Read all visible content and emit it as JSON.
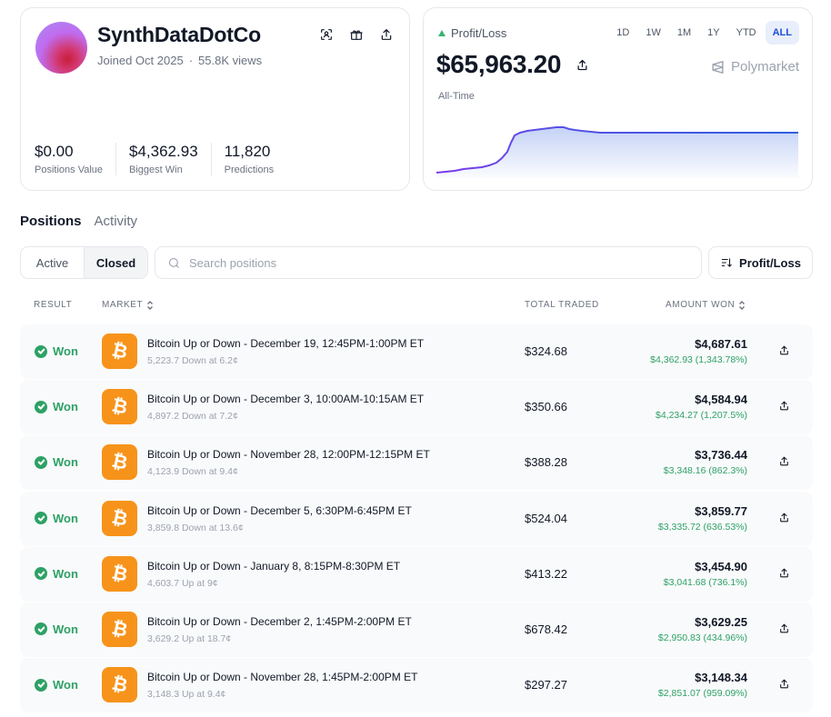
{
  "profile": {
    "username": "SynthDataDotCo",
    "joined": "Joined Oct 2025",
    "views": "55.8K views",
    "separator": "·",
    "stats": [
      {
        "value": "$0.00",
        "label": "Positions Value"
      },
      {
        "value": "$4,362.93",
        "label": "Biggest Win"
      },
      {
        "value": "11,820",
        "label": "Predictions"
      }
    ],
    "icons": [
      "scan-icon",
      "gift-icon",
      "share-icon"
    ]
  },
  "pnl": {
    "label": "Profit/Loss",
    "value": "$65,963.20",
    "brand": "Polymarket",
    "period_label": "All-Time",
    "ranges": [
      "1D",
      "1W",
      "1M",
      "1Y",
      "YTD",
      "ALL"
    ],
    "active_range": "ALL",
    "colors": {
      "line_start": "#7c3aed",
      "line_end": "#2f5fe0",
      "up": "#3bb273"
    }
  },
  "tabs": [
    {
      "label": "Positions",
      "active": true
    },
    {
      "label": "Activity",
      "active": false
    }
  ],
  "filter": {
    "active_label": "Active",
    "closed_label": "Closed",
    "selected": "Closed"
  },
  "search": {
    "placeholder": "Search positions",
    "value": ""
  },
  "sort": {
    "label": "Profit/Loss"
  },
  "table": {
    "headers": {
      "result": "RESULT",
      "market": "MARKET",
      "total_traded": "TOTAL TRADED",
      "amount_won": "AMOUNT WON"
    },
    "rows": [
      {
        "result": "Won",
        "title": "Bitcoin Up or Down - December 19, 12:45PM-1:00PM ET",
        "sub": "5,223.7 Down at 6.2¢",
        "traded": "$324.68",
        "won": "$4,687.61",
        "gain": "$4,362.93 (1,343.78%)"
      },
      {
        "result": "Won",
        "title": "Bitcoin Up or Down - December 3, 10:00AM-10:15AM ET",
        "sub": "4,897.2 Down at 7.2¢",
        "traded": "$350.66",
        "won": "$4,584.94",
        "gain": "$4,234.27 (1,207.5%)"
      },
      {
        "result": "Won",
        "title": "Bitcoin Up or Down - November 28, 12:00PM-12:15PM ET",
        "sub": "4,123.9 Down at 9.4¢",
        "traded": "$388.28",
        "won": "$3,736.44",
        "gain": "$3,348.16 (862.3%)"
      },
      {
        "result": "Won",
        "title": "Bitcoin Up or Down - December 5, 6:30PM-6:45PM ET",
        "sub": "3,859.8 Down at 13.6¢",
        "traded": "$524.04",
        "won": "$3,859.77",
        "gain": "$3,335.72 (636.53%)"
      },
      {
        "result": "Won",
        "title": "Bitcoin Up or Down - January 8, 8:15PM-8:30PM ET",
        "sub": "4,603.7 Up at 9¢",
        "traded": "$413.22",
        "won": "$3,454.90",
        "gain": "$3,041.68 (736.1%)"
      },
      {
        "result": "Won",
        "title": "Bitcoin Up or Down - December 2, 1:45PM-2:00PM ET",
        "sub": "3,629.2 Up at 18.7¢",
        "traded": "$678.42",
        "won": "$3,629.25",
        "gain": "$2,950.83 (434.96%)"
      },
      {
        "result": "Won",
        "title": "Bitcoin Up or Down - November 28, 1:45PM-2:00PM ET",
        "sub": "3,148.3 Up at 9.4¢",
        "traded": "$297.27",
        "won": "$3,148.34",
        "gain": "$2,851.07 (959.09%)"
      }
    ],
    "coin_symbol": "₿"
  }
}
